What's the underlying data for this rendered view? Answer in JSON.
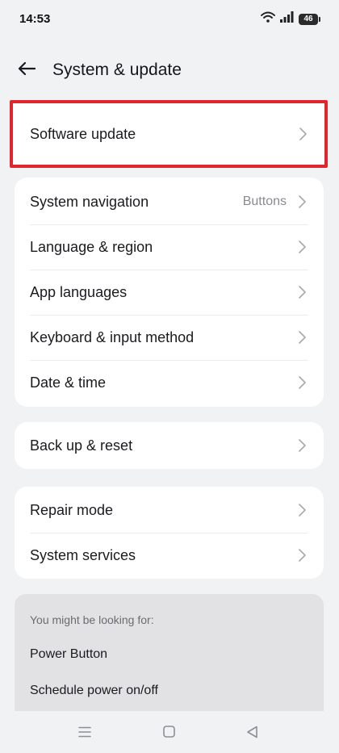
{
  "status_bar": {
    "time": "14:53",
    "battery": "46"
  },
  "header": {
    "title": "System & update"
  },
  "highlight_card": {
    "label": "Software update"
  },
  "system_card": {
    "items": [
      {
        "label": "System navigation",
        "value": "Buttons"
      },
      {
        "label": "Language & region"
      },
      {
        "label": "App languages"
      },
      {
        "label": "Keyboard & input method"
      },
      {
        "label": "Date & time"
      }
    ]
  },
  "backup_card": {
    "items": [
      {
        "label": "Back up & reset"
      }
    ]
  },
  "repair_card": {
    "items": [
      {
        "label": "Repair mode"
      },
      {
        "label": "System services"
      }
    ]
  },
  "suggestions": {
    "heading": "You might be looking for:",
    "items": [
      "Power Button",
      "Schedule power on/off"
    ]
  },
  "icons": {
    "back": "arrow-left-icon",
    "chevron": "chevron-right-icon",
    "wifi": "wifi-icon",
    "signal": "signal-icon",
    "battery": "battery-icon",
    "nav_menu": "menu-icon",
    "nav_home": "square-icon",
    "nav_back": "triangle-back-icon"
  },
  "colors": {
    "highlight_border": "#e0262c",
    "background": "#f1f2f4",
    "card": "#ffffff",
    "suggestion_bg": "#e2e2e4"
  }
}
